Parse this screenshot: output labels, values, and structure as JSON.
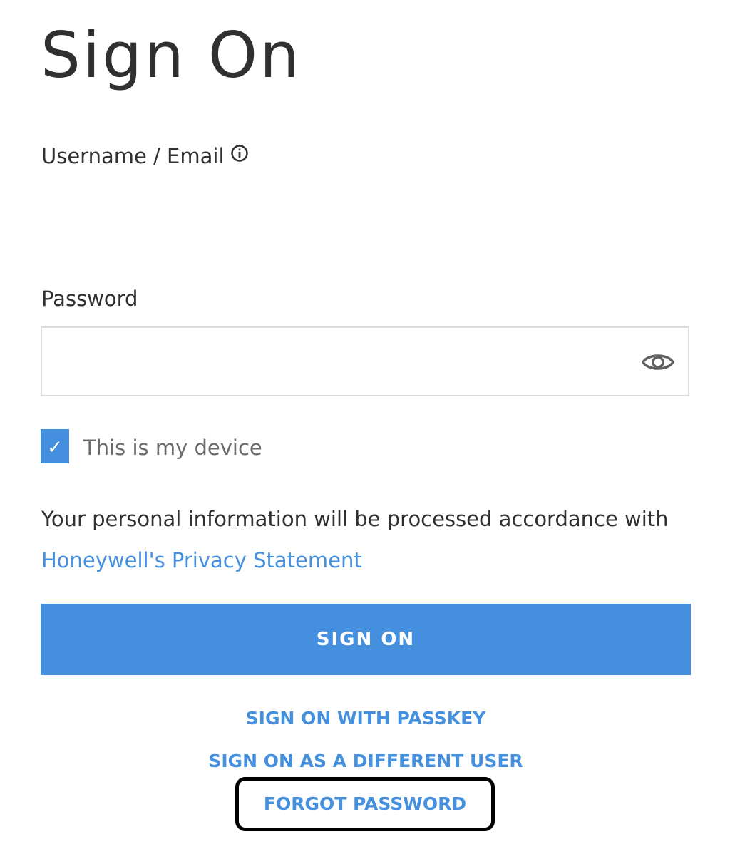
{
  "page": {
    "title": "Sign On"
  },
  "form": {
    "username_label": "Username / Email",
    "password_label": "Password",
    "password_value": "",
    "remember_device_label": "This is my device",
    "remember_device_checked": true
  },
  "privacy": {
    "text": "Your personal information will be processed accordance with",
    "link_label": "Honeywell's Privacy Statement"
  },
  "actions": {
    "sign_on_label": "SIGN ON",
    "passkey_label": "SIGN ON WITH PASSKEY",
    "different_user_label": "SIGN ON AS A DIFFERENT USER",
    "forgot_password_label": "FORGOT PASSWORD"
  },
  "icons": {
    "info": "info-icon",
    "eye": "eye-icon",
    "checkmark": "checkmark-icon"
  },
  "colors": {
    "accent": "#4590de",
    "text": "#303030",
    "muted": "#6b6b6b",
    "field_border": "#dcdcdc"
  }
}
